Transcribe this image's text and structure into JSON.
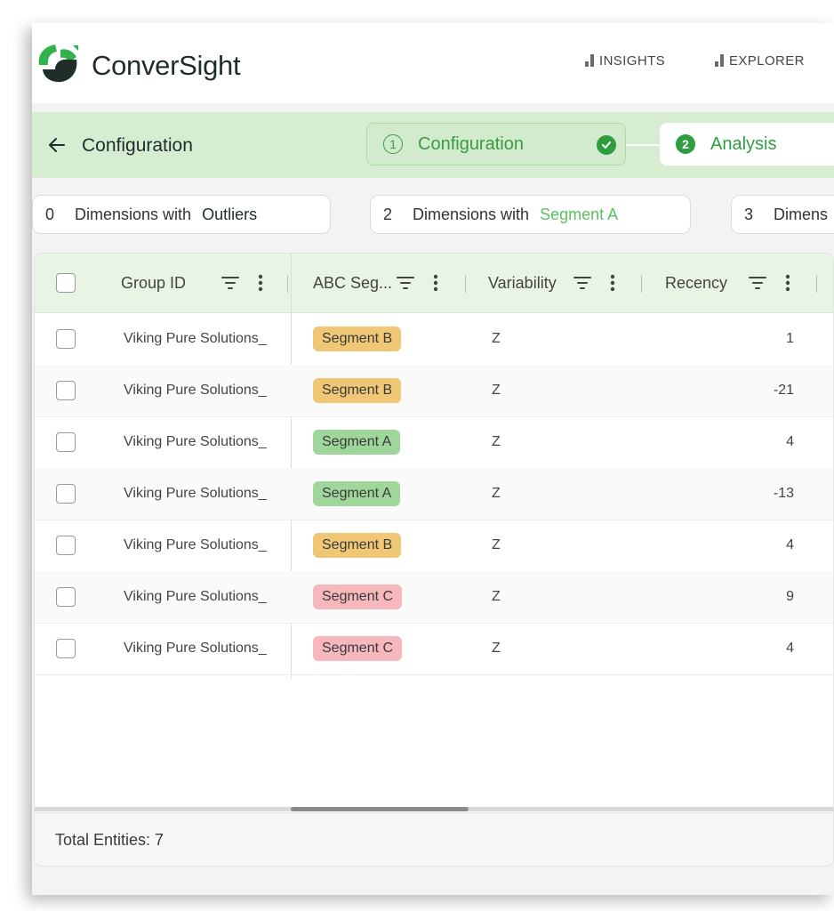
{
  "app": {
    "brand": "ConverSight"
  },
  "nav": {
    "items": [
      {
        "label": "INSIGHTS"
      },
      {
        "label": "EXPLORER"
      }
    ]
  },
  "strip": {
    "title": "Configuration",
    "steps": [
      {
        "number": "1",
        "label": "Configuration",
        "state": "completed"
      },
      {
        "number": "2",
        "label": "Analysis",
        "state": "active"
      }
    ]
  },
  "chips": [
    {
      "count": "0",
      "text": "Dimensions with",
      "highlight": "Outliers"
    },
    {
      "count": "2",
      "text": "Dimensions with",
      "highlight": "Segment A"
    },
    {
      "count": "3",
      "text": "Dimens"
    }
  ],
  "table": {
    "columns": [
      {
        "label": "Group ID"
      },
      {
        "label": "ABC Seg..."
      },
      {
        "label": "Variability"
      },
      {
        "label": "Recency"
      }
    ],
    "rows": [
      {
        "group_id": "Viking Pure Solutions_",
        "segment": "Segment B",
        "variability": "Z",
        "recency": "1"
      },
      {
        "group_id": "Viking Pure Solutions_",
        "segment": "Segment B",
        "variability": "Z",
        "recency": "-21"
      },
      {
        "group_id": "Viking Pure Solutions_",
        "segment": "Segment A",
        "variability": "Z",
        "recency": "4"
      },
      {
        "group_id": "Viking Pure Solutions_",
        "segment": "Segment A",
        "variability": "Z",
        "recency": "-13"
      },
      {
        "group_id": "Viking Pure Solutions_",
        "segment": "Segment B",
        "variability": "Z",
        "recency": "4"
      },
      {
        "group_id": "Viking Pure Solutions_",
        "segment": "Segment C",
        "variability": "Z",
        "recency": "9"
      },
      {
        "group_id": "Viking Pure Solutions_",
        "segment": "Segment C",
        "variability": "Z",
        "recency": "4"
      }
    ],
    "footer": "Total Entities: 7"
  },
  "colors": {
    "accent_green": "#2e9e41",
    "strip_bg": "#d7edd2",
    "segment_a": "#9fd79a",
    "segment_b": "#f0c774",
    "segment_c": "#f6b8bd"
  }
}
